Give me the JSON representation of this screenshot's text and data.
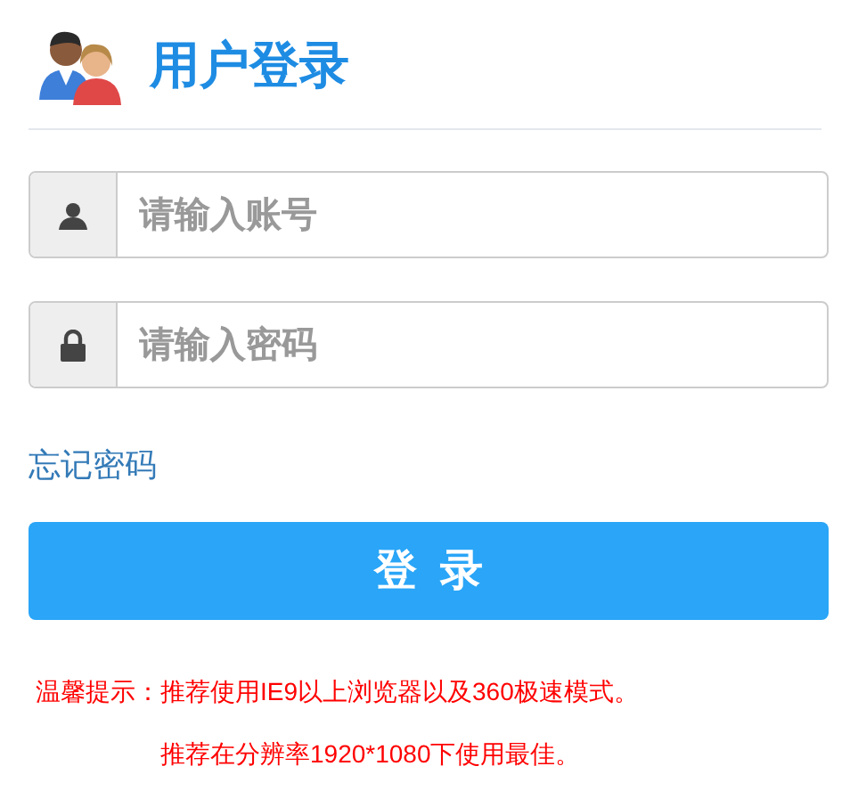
{
  "header": {
    "title": "用户登录"
  },
  "fields": [
    {
      "kind": "user",
      "placeholder": "请输入账号"
    },
    {
      "kind": "lock",
      "placeholder": "请输入密码"
    }
  ],
  "forgot_link": "忘记密码",
  "login_button": "登  录",
  "tips": {
    "label": "温馨提示：",
    "lines": [
      "推荐使用IE9以上浏览器以及360极速模式。",
      "推荐在分辨率1920*1080下使用最佳。"
    ]
  }
}
